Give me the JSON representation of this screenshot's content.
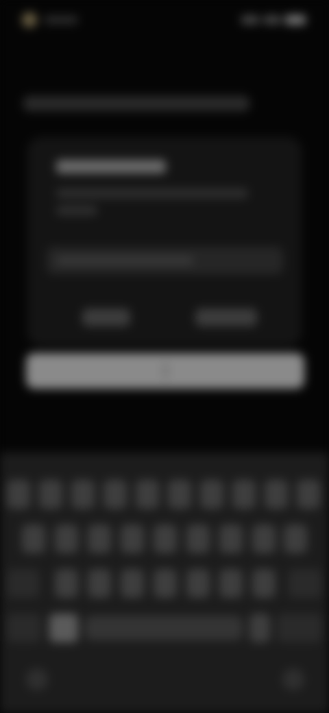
{
  "status_bar": {
    "time": "",
    "icons": [
      "app-icon",
      "signal-icon",
      "wifi-icon",
      "battery-icon"
    ]
  },
  "background": {
    "heading": ""
  },
  "dialog": {
    "title": "",
    "message": "",
    "input_value": "",
    "input_placeholder": "",
    "cancel_label": "",
    "confirm_label": ""
  },
  "suggestions": [
    "",
    ""
  ],
  "keyboard": {
    "rows": [
      [
        "q",
        "w",
        "e",
        "r",
        "t",
        "y",
        "u",
        "i",
        "o",
        "p"
      ],
      [
        "a",
        "s",
        "d",
        "f",
        "g",
        "h",
        "j",
        "k",
        "l"
      ],
      [
        "shift",
        "z",
        "x",
        "c",
        "v",
        "b",
        "n",
        "m",
        "backspace"
      ],
      [
        "symbols",
        "comma",
        "space",
        "period",
        "enter"
      ]
    ],
    "nav": [
      "keyboard-hide-icon",
      "mic-icon"
    ]
  },
  "colors": {
    "background": "#050505",
    "dialog": "#141414",
    "keyboard": "#1c1c1c",
    "key": "#3e3e3e",
    "suggestion_strip": "#8a8a8a"
  }
}
